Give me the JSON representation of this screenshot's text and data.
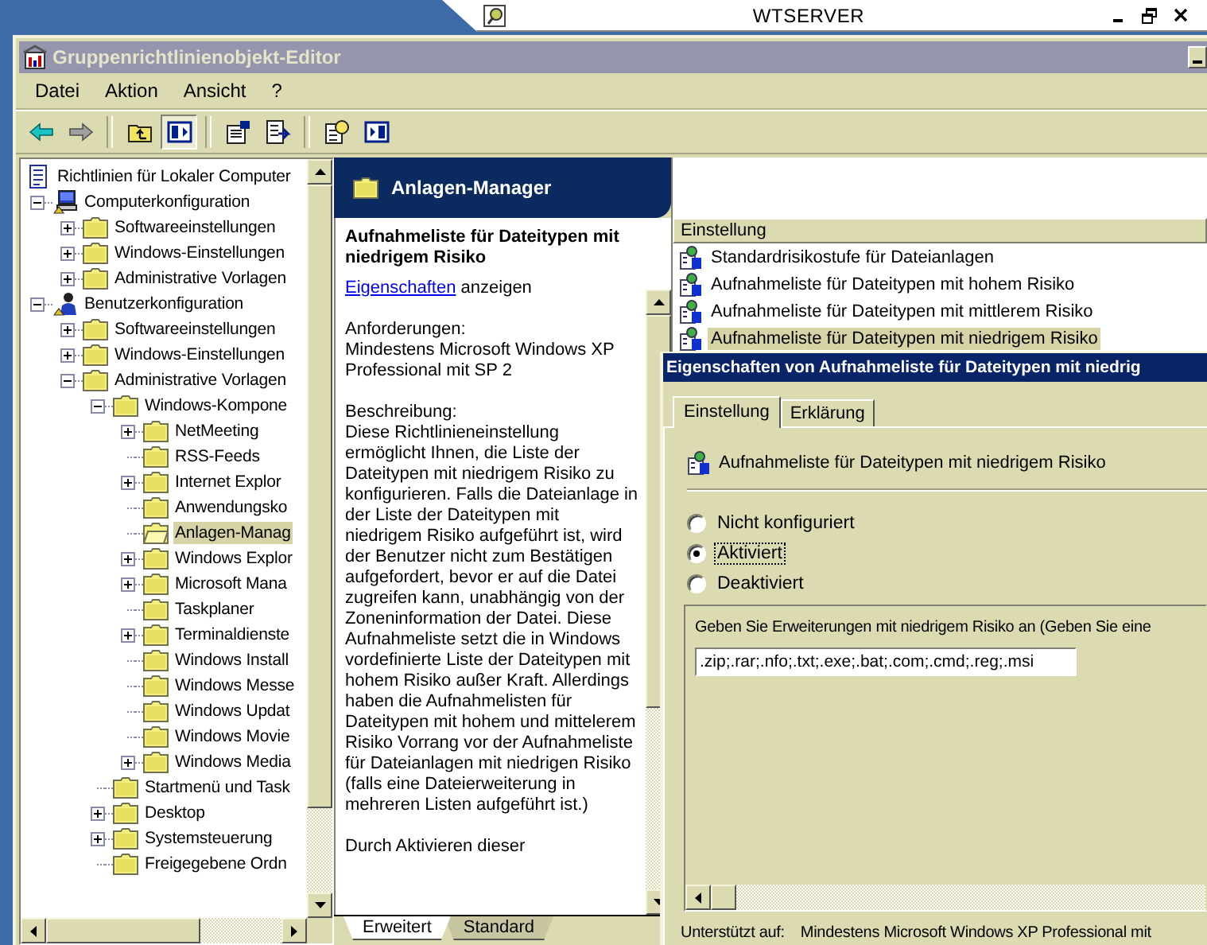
{
  "remote_bar": {
    "title": "WTSERVER"
  },
  "window": {
    "title": "Gruppenrichtlinienobjekt-Editor"
  },
  "menu": [
    "Datei",
    "Aktion",
    "Ansicht",
    "?"
  ],
  "toolbar": [
    {
      "kind": "back",
      "disabled": false,
      "pressed": false
    },
    {
      "kind": "forward",
      "disabled": true,
      "pressed": false
    },
    {
      "kind": "separator"
    },
    {
      "kind": "up",
      "disabled": false,
      "pressed": false
    },
    {
      "kind": "tree",
      "disabled": false,
      "pressed": true
    },
    {
      "kind": "separator"
    },
    {
      "kind": "properties",
      "disabled": false,
      "pressed": false
    },
    {
      "kind": "export",
      "disabled": false,
      "pressed": false
    },
    {
      "kind": "separator"
    },
    {
      "kind": "help",
      "disabled": false,
      "pressed": false
    },
    {
      "kind": "action-pane",
      "disabled": false,
      "pressed": false
    }
  ],
  "tree": {
    "items": [
      {
        "label": "Richtlinien für Lokaler Computer",
        "kind": "policy",
        "selected": false,
        "children": [
          {
            "label": "Computerkonfiguration",
            "kind": "computer",
            "selected": false,
            "expanded": true,
            "children": [
              {
                "label": "Softwareeinstellungen",
                "kind": "folder",
                "selected": false,
                "expanded": false
              },
              {
                "label": "Windows-Einstellungen",
                "kind": "folder",
                "selected": false,
                "expanded": false
              },
              {
                "label": "Administrative Vorlagen",
                "kind": "folder",
                "selected": false,
                "expanded": false
              }
            ]
          },
          {
            "label": "Benutzerkonfiguration",
            "kind": "user",
            "selected": false,
            "expanded": true,
            "children": [
              {
                "label": "Softwareeinstellungen",
                "kind": "folder",
                "selected": false,
                "expanded": false
              },
              {
                "label": "Windows-Einstellungen",
                "kind": "folder",
                "selected": false,
                "expanded": false
              },
              {
                "label": "Administrative Vorlagen",
                "kind": "folder",
                "selected": false,
                "expanded": true,
                "children": [
                  {
                    "label": "Windows-Kompone",
                    "kind": "folder",
                    "selected": false,
                    "expanded": true,
                    "children": [
                      {
                        "label": "NetMeeting",
                        "kind": "folder",
                        "selected": false,
                        "expanded": false
                      },
                      {
                        "label": "RSS-Feeds",
                        "kind": "folder",
                        "selected": false
                      },
                      {
                        "label": "Internet Explor",
                        "kind": "folder",
                        "selected": false,
                        "expanded": false
                      },
                      {
                        "label": "Anwendungsko",
                        "kind": "folder",
                        "selected": false
                      },
                      {
                        "label": "Anlagen-Manag",
                        "kind": "folder",
                        "selected": true
                      },
                      {
                        "label": "Windows Explor",
                        "kind": "folder",
                        "selected": false,
                        "expanded": false
                      },
                      {
                        "label": "Microsoft Mana",
                        "kind": "folder",
                        "selected": false,
                        "expanded": false
                      },
                      {
                        "label": "Taskplaner",
                        "kind": "folder",
                        "selected": false
                      },
                      {
                        "label": "Terminaldienste",
                        "kind": "folder",
                        "selected": false,
                        "expanded": false
                      },
                      {
                        "label": "Windows Install",
                        "kind": "folder",
                        "selected": false
                      },
                      {
                        "label": "Windows Messe",
                        "kind": "folder",
                        "selected": false
                      },
                      {
                        "label": "Windows Updat",
                        "kind": "folder",
                        "selected": false
                      },
                      {
                        "label": "Windows Movie",
                        "kind": "folder",
                        "selected": false
                      },
                      {
                        "label": "Windows Media",
                        "kind": "folder",
                        "selected": false,
                        "expanded": false
                      }
                    ]
                  },
                  {
                    "label": "Startmenü und Task",
                    "kind": "folder",
                    "selected": false
                  },
                  {
                    "label": "Desktop",
                    "kind": "folder",
                    "selected": false,
                    "expanded": false
                  },
                  {
                    "label": "Systemsteuerung",
                    "kind": "folder",
                    "selected": false,
                    "expanded": false
                  },
                  {
                    "label": "Freigegebene Ordn",
                    "kind": "folder",
                    "selected": false
                  }
                ]
              }
            ]
          }
        ]
      }
    ]
  },
  "details": {
    "header": "Anlagen-Manager",
    "title": "Aufnahmeliste für Dateitypen mit niedrigem Risiko",
    "link": "Eigenschaften",
    "link_suffix": "anzeigen",
    "requirements_label": "Anforderungen:",
    "requirements": "Mindestens Microsoft Windows XP Professional mit SP 2",
    "description_label": "Beschreibung:",
    "description": "Diese Richtlinieneinstellung ermöglicht Ihnen, die Liste der Dateitypen mit niedrigem Risiko zu konfigurieren. Falls die Dateianlage in der Liste der Dateitypen mit niedrigem Risiko aufgeführt ist, wird der Benutzer nicht zum Bestätigen aufgefordert, bevor er auf die Datei zugreifen kann, unabhängig von der Zoneninformation der Datei. Diese Aufnahmeliste setzt die in Windows vordefinierte Liste der Dateitypen mit hohem Risiko außer Kraft. Allerdings haben die Aufnahmelisten für Dateitypen mit hohem und mittelerem Risiko Vorrang vor der Aufnahmeliste für Dateianlagen mit niedrigen Risiko (falls eine Dateierweiterung in mehreren Listen aufgeführt ist.)",
    "more": "Durch Aktivieren dieser"
  },
  "detail_tabs": [
    {
      "label": "Erweitert",
      "selected": true
    },
    {
      "label": "Standard",
      "selected": false
    }
  ],
  "settings_list": {
    "columns": [
      "Einstellung"
    ],
    "rows": [
      {
        "name": "Standardrisikostufe für Dateianlagen",
        "selected": false
      },
      {
        "name": "Aufnahmeliste für Dateitypen mit hohem Risiko",
        "selected": false
      },
      {
        "name": "Aufnahmeliste für Dateitypen mit mittlerem Risiko",
        "selected": false
      },
      {
        "name": "Aufnahmeliste für Dateitypen mit niedrigem Risiko",
        "selected": true
      }
    ]
  },
  "dialog": {
    "title": "Eigenschaften von Aufnahmeliste für Dateitypen mit niedrig",
    "tabs": [
      {
        "label": "Einstellung",
        "selected": true
      },
      {
        "label": "Erklärung",
        "selected": false
      }
    ],
    "policy_name": "Aufnahmeliste für Dateitypen mit niedrigem Risiko",
    "options": [
      {
        "label": "Nicht konfiguriert",
        "selected": false,
        "focused": false
      },
      {
        "label": "Aktiviert",
        "selected": true,
        "focused": true
      },
      {
        "label": "Deaktiviert",
        "selected": false,
        "focused": false
      }
    ],
    "group_label": "Geben Sie Erweiterungen mit niedrigem Risiko an (Geben Sie eine",
    "value": ".zip;.rar;.nfo;.txt;.exe;.bat;.com;.cmd;.reg;.msi",
    "supported_label": "Unterstützt auf:",
    "supported_value": "Mindestens Microsoft Windows XP Professional mit"
  }
}
